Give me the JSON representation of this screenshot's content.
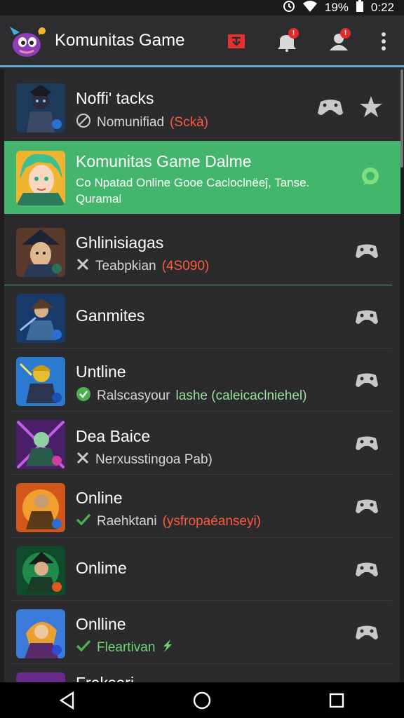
{
  "status_bar": {
    "battery_text": "19%",
    "time": "0:22",
    "icons": [
      "alarm-icon",
      "wifi-icon",
      "battery-icon"
    ]
  },
  "app_bar": {
    "title": "Komunitas Game",
    "actions": [
      {
        "icon": "download-icon",
        "color": "#e53030"
      },
      {
        "icon": "notifications-icon",
        "badge": "!"
      },
      {
        "icon": "profile-icon",
        "badge": "!"
      },
      {
        "icon": "more-vert-icon"
      }
    ]
  },
  "colors": {
    "accent_blue": "#5fa9d6",
    "highlight_green": "#43b56c",
    "status_red": "#ff5a3c",
    "status_green": "#9ae29a",
    "badge_red": "#e52a2a"
  },
  "list": {
    "items": [
      {
        "title": "Noffiʹ tacks",
        "status_icon": "blocked-icon",
        "subtitle": "Nomunifiad",
        "subtitle_tag": "(Sckà)",
        "tag_color": "red",
        "actions": [
          "controller-icon",
          "star-icon"
        ]
      },
      {
        "title": "Komunitas Game Dalme",
        "subtitle": "Co Npatad Online Gooe Cacloclnëeĵ, Tanse. Quramal",
        "highlighted": true,
        "actions": [
          "chat-icon"
        ]
      },
      {
        "title": "Ghlinisiagas",
        "status_icon": "cross-icon",
        "subtitle": "Teabpkian",
        "subtitle_tag": "(4S090)",
        "tag_color": "red",
        "actions": [
          "controller-icon"
        ]
      },
      {
        "title": "Ganmites",
        "actions": [
          "controller-icon"
        ]
      },
      {
        "title": "Untline",
        "status_icon": "check-circle-icon",
        "subtitle": "Ralscasyour",
        "subtitle_tag": "lashe (caleicaclniehel)",
        "tag_color": "green",
        "actions": [
          "controller-icon"
        ]
      },
      {
        "title": "Dea Baice",
        "status_icon": "cross-icon",
        "subtitle": "Nerxusstingoa Pab)",
        "actions": [
          "controller-icon"
        ]
      },
      {
        "title": "Online",
        "status_icon": "check-icon",
        "subtitle": "Raehktani",
        "subtitle_tag": "(ysfropaéanseyi)",
        "tag_color": "red",
        "actions": [
          "controller-icon"
        ]
      },
      {
        "title": "Onlime",
        "actions": [
          "controller-icon"
        ]
      },
      {
        "title": "Onlline",
        "status_icon": "check-icon",
        "subtitle": "Fleartivan",
        "subtitle_color": "green",
        "trailing_icon": "lightning-icon",
        "actions": [
          "controller-icon"
        ]
      },
      {
        "title": "Fraksari",
        "partial": true
      }
    ]
  },
  "nav_bar": {
    "buttons": [
      "back-icon",
      "home-icon",
      "recents-icon"
    ]
  }
}
